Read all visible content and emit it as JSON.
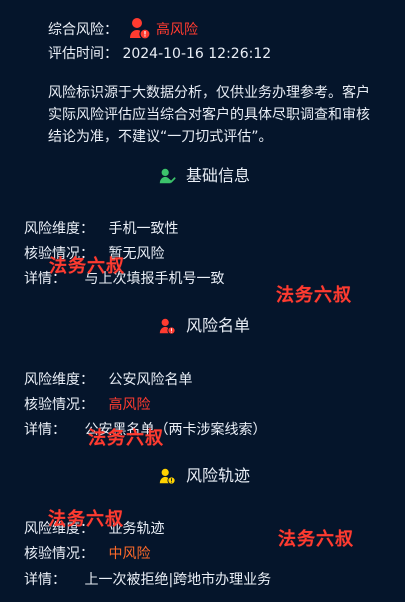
{
  "header": {
    "overall_risk_label": "综合风险：",
    "overall_risk_value": "高风险",
    "eval_time_label": "评估时间：",
    "eval_time_value": "2024-10-16 12:26:12"
  },
  "note": {
    "text": "风险标识源于大数据分析，仅供业务办理参考。客户实际风险评估应当综合对客户的具体尽职调查和审核结论为准，不建议“一刀切式评估”。"
  },
  "sections": [
    {
      "title": "基础信息",
      "icon": "person-check-icon",
      "rows": [
        {
          "label": "风险维度：",
          "value": "手机一致性"
        },
        {
          "label": "核验情况：",
          "value": "暂无风险"
        },
        {
          "label": "详情：",
          "value": "与上次填报手机号一致"
        }
      ]
    },
    {
      "title": "风险名单",
      "icon": "person-alert-icon",
      "rows": [
        {
          "label": "风险维度：",
          "value": "公安风险名单"
        },
        {
          "label": "核验情况：",
          "value": "高风险"
        },
        {
          "label": "详情：",
          "value": "公安黑名单（两卡涉案线索）"
        }
      ]
    },
    {
      "title": "风险轨迹",
      "icon": "person-warning-icon",
      "rows": [
        {
          "label": "风险维度：",
          "value": "业务轨迹"
        },
        {
          "label": "核验情况：",
          "value": "中风险"
        },
        {
          "label": "详情：",
          "value": "上一次被拒绝|跨地市办理业务"
        }
      ]
    }
  ],
  "watermark": {
    "text": "法务六叔"
  },
  "colors": {
    "background": "#05152b",
    "text": "#e9eef6",
    "high_risk": "#ff3b30",
    "mid_risk": "#ff6a2a",
    "ok_green": "#3cc36b",
    "warn_yellow": "#ffd200"
  }
}
